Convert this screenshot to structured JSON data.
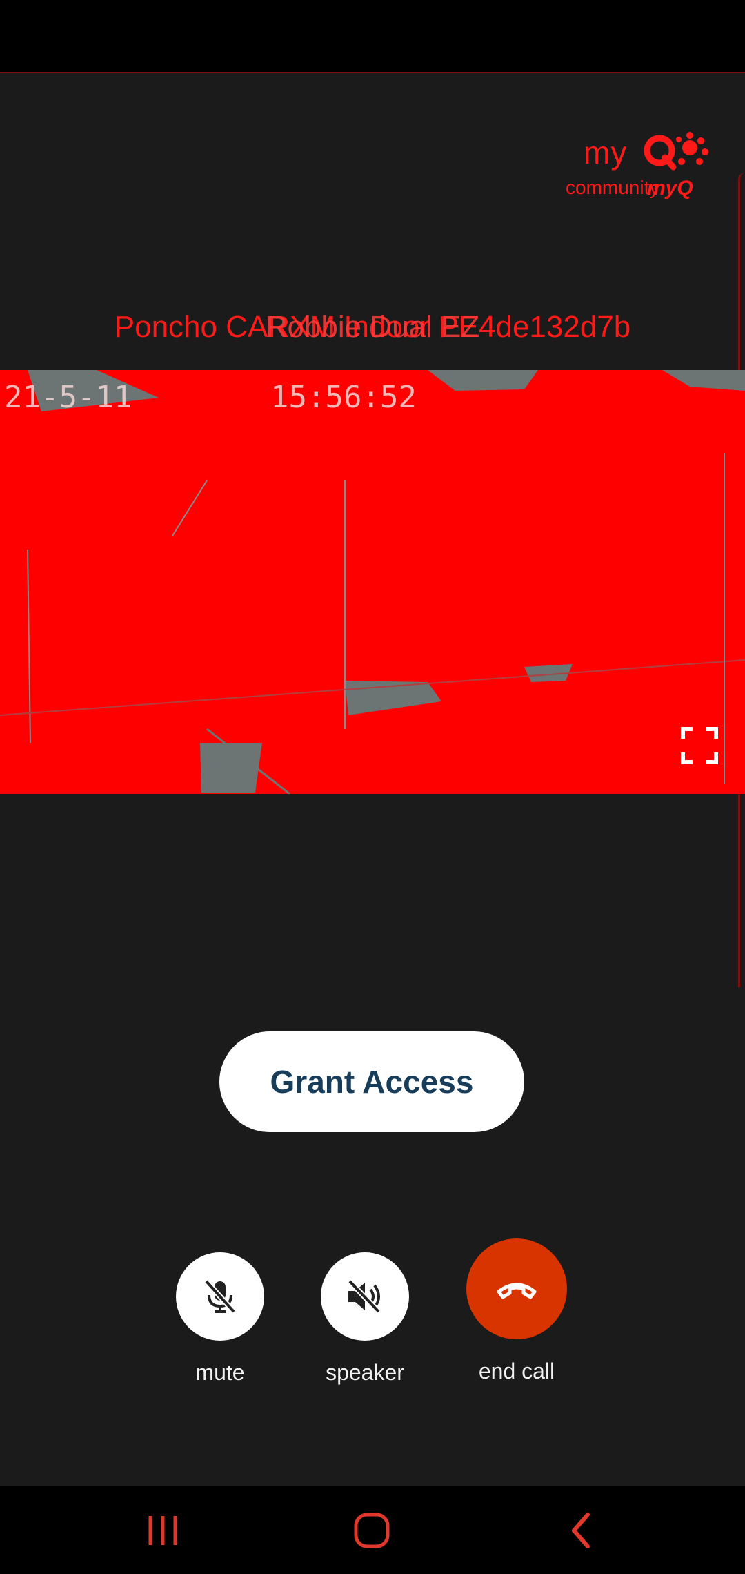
{
  "brand": {
    "logo_primary": "my",
    "logo_secondary": "community",
    "logo_overlay": "myQ",
    "accent_color": "#ff1a1a"
  },
  "call": {
    "title_primary": "Poncho CARXM Indoor PE4de132d7b",
    "title_overlay": "Robbie Dual EZ",
    "video_date_overlay": "21-5-11",
    "video_time_overlay": "15:56:52"
  },
  "actions": {
    "grant_access_label": "Grant Access",
    "grant_access_text_color": "#173d5a"
  },
  "controls": {
    "mute_label": "mute",
    "speaker_label": "speaker",
    "end_call_label": "end call",
    "end_call_color": "#d83400"
  },
  "icons": {
    "fullscreen": "fullscreen-icon",
    "mute": "microphone-off-icon",
    "speaker": "speaker-off-icon",
    "end_call": "phone-hangup-icon",
    "nav_recent": "recent-apps-icon",
    "nav_home": "home-icon",
    "nav_back": "back-icon"
  }
}
